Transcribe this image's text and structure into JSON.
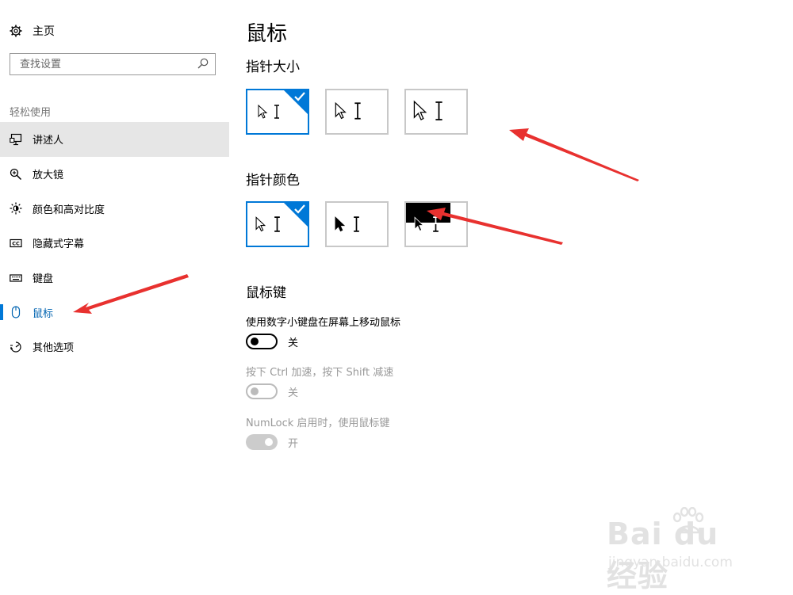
{
  "sidebar": {
    "home_label": "主页",
    "search_placeholder": "查找设置",
    "section_label": "轻松使用",
    "items": [
      {
        "label": "讲述人",
        "icon": "narrator-icon"
      },
      {
        "label": "放大镜",
        "icon": "magnifier-icon"
      },
      {
        "label": "颜色和高对比度",
        "icon": "brightness-icon"
      },
      {
        "label": "隐藏式字幕",
        "icon": "closed-caption-icon"
      },
      {
        "label": "键盘",
        "icon": "keyboard-icon"
      },
      {
        "label": "鼠标",
        "icon": "mouse-icon"
      },
      {
        "label": "其他选项",
        "icon": "other-options-icon"
      }
    ]
  },
  "main": {
    "title": "鼠标",
    "pointer_size": {
      "title": "指针大小",
      "selected_index": 0
    },
    "pointer_color": {
      "title": "指针颜色",
      "selected_index": 0
    },
    "mouse_keys": {
      "title": "鼠标键",
      "setting1_label": "使用数字小键盘在屏幕上移动鼠标",
      "setting1_state": "关",
      "setting2_label": "按下 Ctrl 加速，按下 Shift 减速",
      "setting2_state": "关",
      "setting3_label": "NumLock 启用时，使用鼠标键",
      "setting3_state": "开"
    }
  },
  "watermark": {
    "brand": "Bai du 经验",
    "url": "jingyan.baidu.com"
  },
  "colors": {
    "accent": "#0078d7",
    "arrow": "#e8312f",
    "hover": "#e6e6e6"
  }
}
